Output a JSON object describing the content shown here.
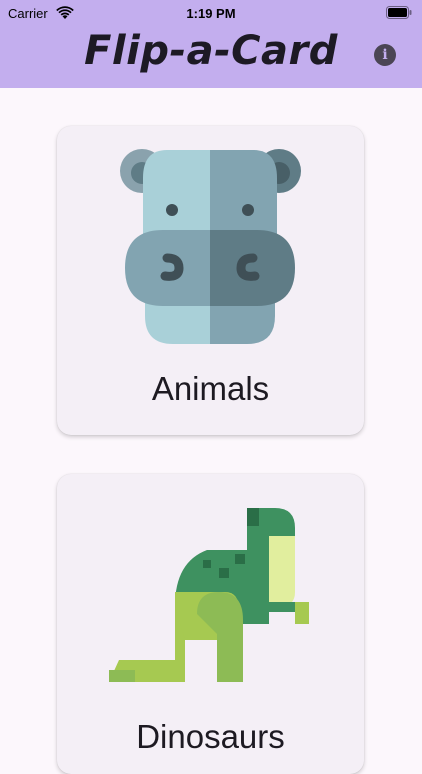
{
  "status_bar": {
    "carrier": "Carrier",
    "time": "1:19 PM"
  },
  "header": {
    "title": "Flip-a-Card",
    "info_glyph": "i",
    "background": "#c3aeee"
  },
  "categories": [
    {
      "label": "Animals",
      "icon": "hippo-icon"
    },
    {
      "label": "Dinosaurs",
      "icon": "dinosaur-icon"
    }
  ]
}
